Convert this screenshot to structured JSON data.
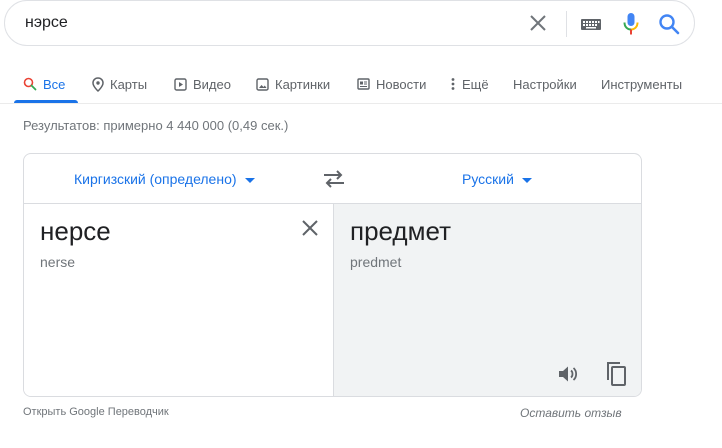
{
  "search": {
    "query": "нэрсе",
    "icons": [
      "close-icon",
      "keyboard-icon",
      "microphone-icon",
      "search-icon"
    ]
  },
  "tabs": [
    {
      "label": "Все",
      "icon": "search-icon",
      "active": true
    },
    {
      "label": "Карты",
      "icon": "map-pin-icon"
    },
    {
      "label": "Видео",
      "icon": "video-icon"
    },
    {
      "label": "Картинки",
      "icon": "image-icon"
    },
    {
      "label": "Новости",
      "icon": "news-icon"
    },
    {
      "label": "Ещё",
      "icon": "more-vert-icon"
    },
    {
      "label": "Настройки"
    },
    {
      "label": "Инструменты"
    }
  ],
  "result_stats": "Результатов: примерно 4 440 000 (0,49 сек.)",
  "translate": {
    "source_lang": "Киргизский (определено)",
    "target_lang": "Русский",
    "source_text": "нерсе",
    "source_translit": "nerse",
    "target_text": "предмет",
    "target_translit": "predmet"
  },
  "footer": {
    "open_translator": "Открыть Google Переводчик",
    "feedback": "Оставить отзыв"
  },
  "colors": {
    "accent": "#1a73e8",
    "muted": "#70757a",
    "target_pane_bg": "#f1f3f4"
  }
}
